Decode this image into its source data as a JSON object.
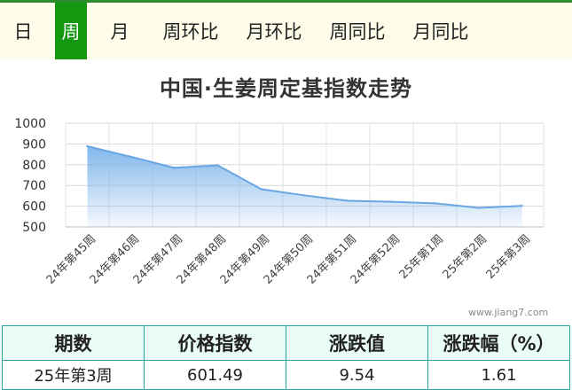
{
  "tabs": [
    {
      "label": "日"
    },
    {
      "label": "周"
    },
    {
      "label": "月"
    },
    {
      "label": "周环比"
    },
    {
      "label": "月环比"
    },
    {
      "label": "周同比"
    },
    {
      "label": "月同比"
    }
  ],
  "active_tab": "周",
  "chart_data": {
    "type": "area",
    "title": "中国·生姜周定基指数走势",
    "categories": [
      "24年第45周",
      "24年第46周",
      "24年第47周",
      "24年第48周",
      "24年第49周",
      "24年第50周",
      "24年第51周",
      "24年第52周",
      "25年第1周",
      "25年第2周",
      "25年第3周"
    ],
    "series": [
      {
        "values": [
          889,
          838,
          785,
          797,
          682,
          652,
          626,
          621,
          614,
          592,
          601.49
        ]
      }
    ],
    "y_ticks": [
      500,
      600,
      700,
      800,
      900,
      1000
    ],
    "ylim": [
      500,
      1000
    ],
    "grid": true,
    "color": "#7ab3ea"
  },
  "watermark": "www.jiang7.com",
  "table": {
    "headers": [
      "期数",
      "价格指数",
      "涨跌值",
      "涨跌幅（%）"
    ],
    "row": [
      "25年第3周",
      "601.49",
      "9.54",
      "1.61"
    ]
  }
}
